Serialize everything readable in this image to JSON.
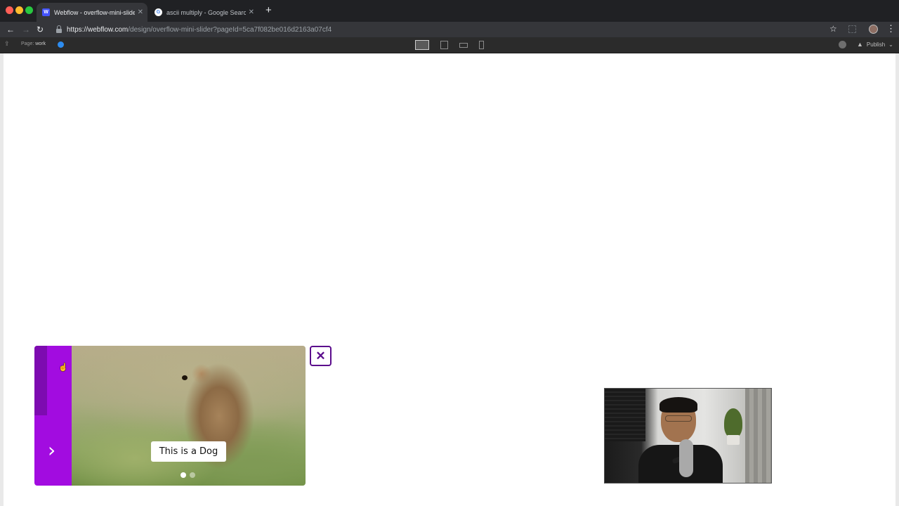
{
  "browser": {
    "tabs": [
      {
        "title": "Webflow - overflow-mini-slider",
        "favicon": "webflow-icon",
        "active": true
      },
      {
        "title": "ascii multiply - Google Search",
        "favicon": "google-icon",
        "active": false
      }
    ],
    "new_tab_symbol": "+",
    "url_host": "https://webflow.com",
    "url_path": "/design/overflow-mini-slider?pageId=5ca7f082be016d2163a07cf4",
    "icons": {
      "back": "←",
      "forward": "→",
      "reload": "↻",
      "star": "☆",
      "menu": "⋮",
      "close": "✕"
    }
  },
  "designer": {
    "page_label": "Page:",
    "page_value": "work",
    "publish_label": "Publish",
    "publish_icon": "▲",
    "upload_icon": "⇪",
    "chevron": "⌄",
    "breakpoints": [
      "desktop",
      "tablet",
      "mobile-landscape",
      "mobile-portrait"
    ],
    "active_breakpoint": "desktop"
  },
  "slider": {
    "caption": "This is a Dog",
    "arrow": "›",
    "slide_count": 2,
    "active_slide": 1,
    "accent_color": "#a20ce0",
    "dark_accent_color": "#7d0bb0"
  },
  "close_button": {
    "symbol": "✕",
    "color": "#5b0c8c"
  },
  "cursor": {
    "symbol": "☝"
  }
}
